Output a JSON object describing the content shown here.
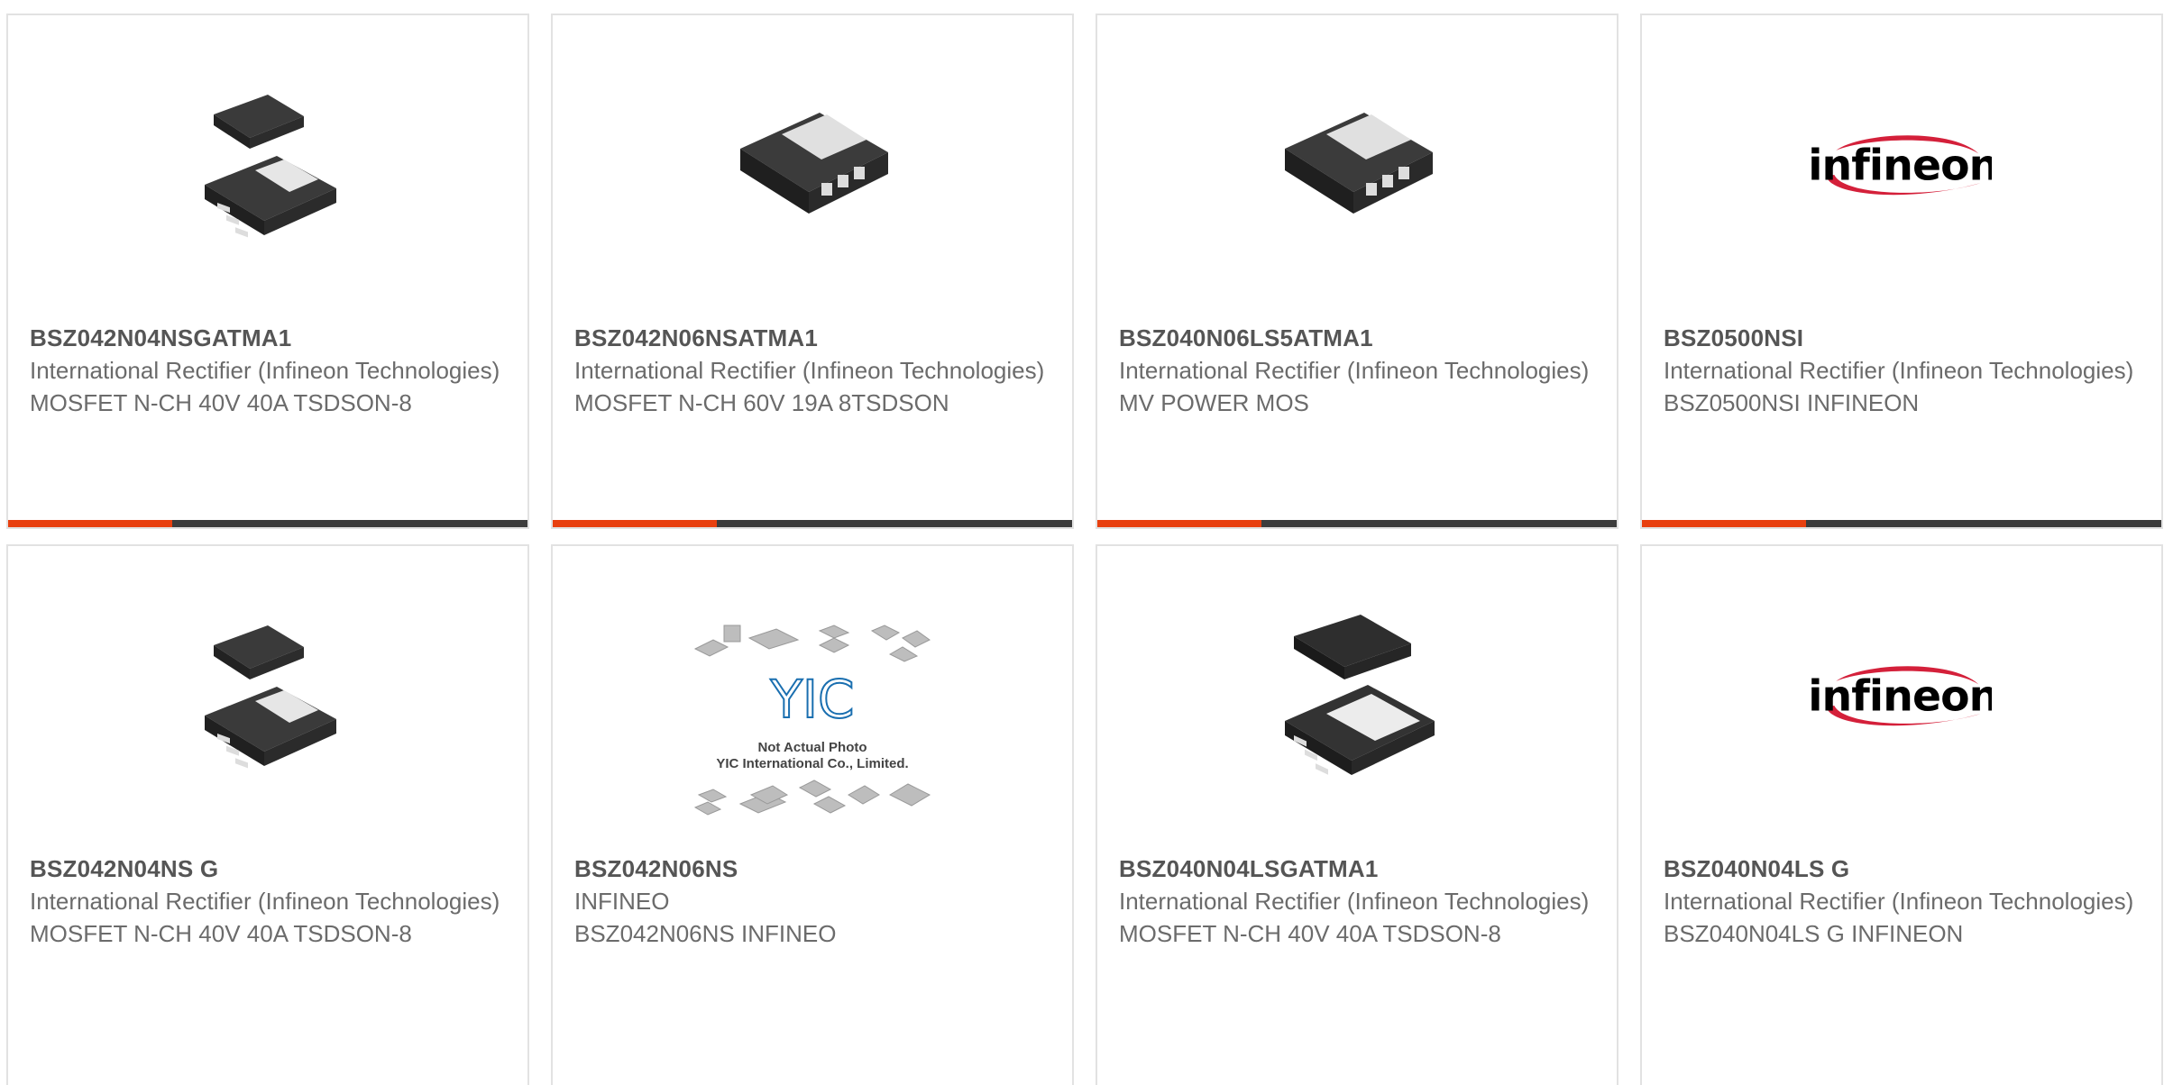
{
  "products": [
    {
      "part_number": "BSZ042N04NSGATMA1",
      "manufacturer": "International Rectifier (Infineon Technologies)",
      "description": "MOSFET N-CH 40V 40A TSDSON-8",
      "image": "chip-stack-icon"
    },
    {
      "part_number": "BSZ042N06NSATMA1",
      "manufacturer": "International Rectifier (Infineon Technologies)",
      "description": "MOSFET N-CH 60V 19A 8TSDSON",
      "image": "chip-icon"
    },
    {
      "part_number": "BSZ040N06LS5ATMA1",
      "manufacturer": "International Rectifier (Infineon Technologies)",
      "description": "MV POWER MOS",
      "image": "chip-icon"
    },
    {
      "part_number": "BSZ0500NSI",
      "manufacturer": "International Rectifier (Infineon Technologies)",
      "description": "BSZ0500NSI INFINEON",
      "image": "infineon-logo"
    },
    {
      "part_number": "BSZ042N04NS G",
      "manufacturer": "International Rectifier (Infineon Technologies)",
      "description": "MOSFET N-CH 40V 40A TSDSON-8",
      "image": "chip-stack-icon"
    },
    {
      "part_number": "BSZ042N06NS",
      "manufacturer": "INFINEO",
      "description": "BSZ042N06NS INFINEO",
      "image": "placeholder-photo",
      "placeholder_text": {
        "logo": "YIC",
        "line1": "Not Actual Photo",
        "line2": "YIC International Co., Limited."
      }
    },
    {
      "part_number": "BSZ040N04LSGATMA1",
      "manufacturer": "International Rectifier (Infineon Technologies)",
      "description": "MOSFET N-CH 40V 40A TSDSON-8",
      "image": "chip-stack-icon"
    },
    {
      "part_number": "BSZ040N04LS G",
      "manufacturer": "International Rectifier (Infineon Technologies)",
      "description": "BSZ040N04LS G INFINEON",
      "image": "infineon-logo"
    }
  ],
  "logo_text": "infineon",
  "colors": {
    "accent": "#e8400f",
    "bar_dark": "#3c3c3c",
    "border": "#e2e2e2",
    "part_number_text": "#555555",
    "body_text": "#6b6b6b",
    "logo_blue": "#1b5fa5",
    "logo_red": "#d4203a"
  }
}
